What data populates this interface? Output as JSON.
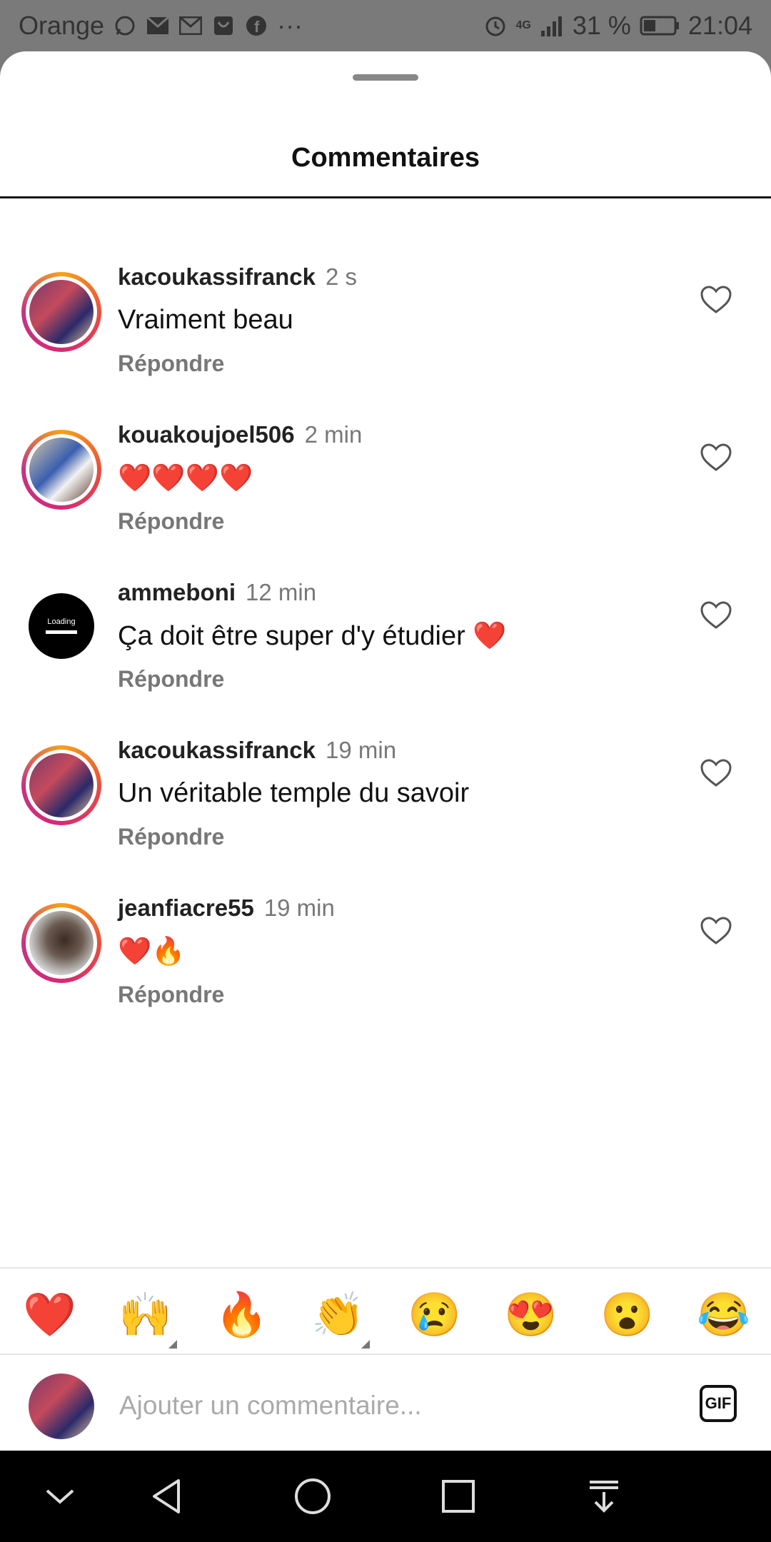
{
  "status_bar": {
    "carrier": "Orange",
    "notification_icons": [
      "whatsapp-icon",
      "mail-icon",
      "gmail-icon",
      "shopping-bag-icon",
      "facebook-icon",
      "more-icon"
    ],
    "network": "4G",
    "battery": "31 %",
    "time": "21:04"
  },
  "sheet": {
    "title": "Commentaires"
  },
  "comments": [
    {
      "user": "kacoukassifranck",
      "time": "2 s",
      "text": "Vraiment beau",
      "reply": "Répondre"
    },
    {
      "user": "kouakoujoel506",
      "time": "2 min",
      "text": "❤️❤️❤️❤️",
      "reply": "Répondre"
    },
    {
      "user": "ammeboni",
      "time": "12 min",
      "text": "Ça doit être super d'y étudier ❤️",
      "reply": "Répondre",
      "avatar_text": "Loading"
    },
    {
      "user": "kacoukassifranck",
      "time": "19 min",
      "text": "Un véritable temple du savoir",
      "reply": "Répondre"
    },
    {
      "user": "jeanfiacre55",
      "time": "19 min",
      "text": "❤️🔥",
      "reply": "Répondre"
    }
  ],
  "emoji_bar": [
    "❤️",
    "🙌",
    "🔥",
    "👏",
    "😢",
    "😍",
    "😮",
    "😂"
  ],
  "composer": {
    "placeholder": "Ajouter un commentaire...",
    "gif_label": "GIF"
  },
  "nav": [
    "collapse-icon",
    "back-icon",
    "home-icon",
    "recents-icon",
    "notification-shade-icon"
  ],
  "colors": {
    "ring_gradient": [
      "#f7a21b",
      "#d62976"
    ],
    "meta_gray": "#777777"
  }
}
